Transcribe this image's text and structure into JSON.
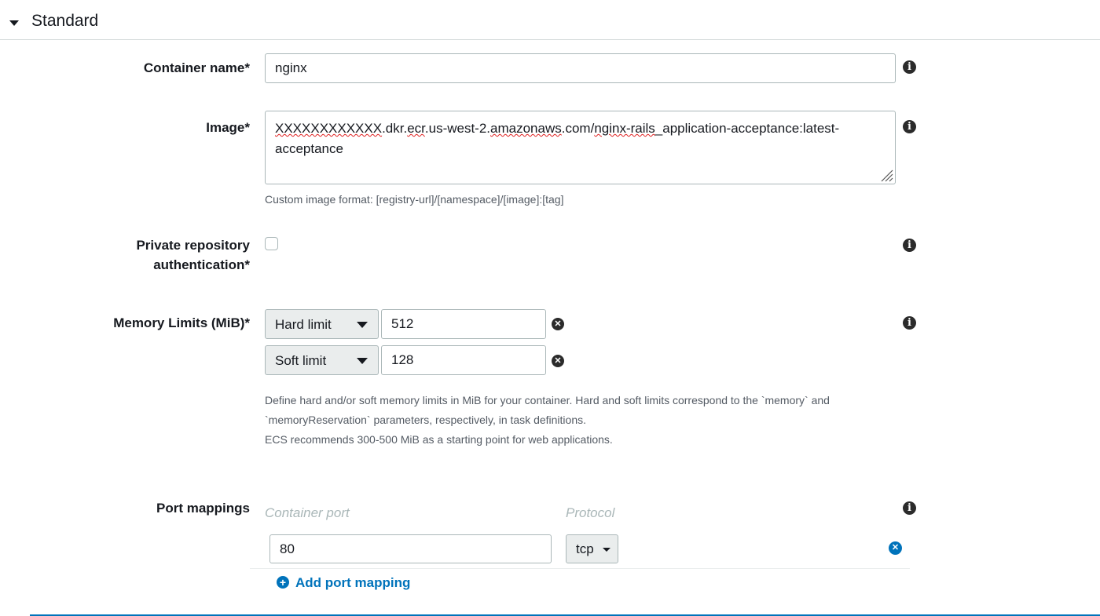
{
  "section": {
    "title": "Standard",
    "icon": "caret-down-icon"
  },
  "container_name": {
    "label": "Container name*",
    "value": "nginx"
  },
  "image": {
    "label": "Image*",
    "value_parts": [
      "XXXXXXXXXXXX",
      ".dkr.",
      "ecr",
      ".us-west-2.",
      "amazonaws",
      ".com/",
      "nginx-rails",
      "_application-acceptance:latest-"
    ],
    "value_line2": "acceptance",
    "help": "Custom image format: [registry-url]/[namespace]/[image]:[tag]"
  },
  "private_repo": {
    "label_line1": "Private repository",
    "label_line2": "authentication*",
    "checked": false
  },
  "memory": {
    "label": "Memory Limits (MiB)*",
    "rows": [
      {
        "type": "Hard limit",
        "value": "512"
      },
      {
        "type": "Soft limit",
        "value": "128"
      }
    ],
    "help_line1": "Define hard and/or soft memory limits in MiB for your container. Hard and soft limits correspond to the `memory` and",
    "help_line2": "`memoryReservation` parameters, respectively, in task definitions.",
    "help_line3": "ECS recommends 300-500 MiB as a starting point for web applications."
  },
  "ports": {
    "label": "Port mappings",
    "col_container_port": "Container port",
    "col_protocol": "Protocol",
    "rows": [
      {
        "container_port": "80",
        "protocol": "tcp"
      }
    ],
    "add_label": "Add port mapping"
  },
  "colors": {
    "accent": "#0073bb",
    "border": "#aab7b8",
    "help_text": "#545b64",
    "spellcheck": "#e02020"
  }
}
